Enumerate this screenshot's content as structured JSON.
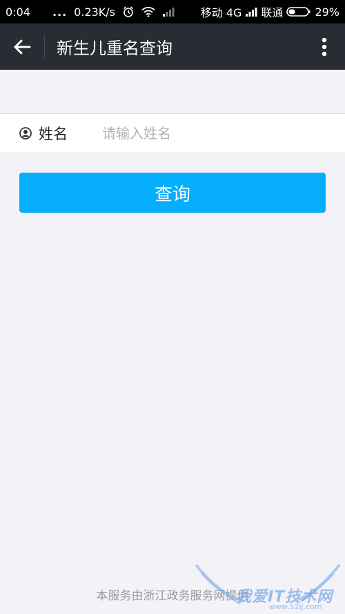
{
  "status_bar": {
    "time": "0:04",
    "dots": "...",
    "speed": "0.23K/s",
    "carrier1": "移动 4G",
    "carrier2": "联通",
    "battery": "29%",
    "icons": [
      "alarm-icon",
      "wifi-icon",
      "signal-icon",
      "signal-icon",
      "battery-icon"
    ]
  },
  "title_bar": {
    "title": "新生儿重名查询",
    "icons": [
      "back-arrow-icon",
      "more-vertical-icon"
    ]
  },
  "form": {
    "name_label": "姓名",
    "name_placeholder": "请输入姓名",
    "name_value": "",
    "icon": "user-icon"
  },
  "query_button": {
    "label": "查询"
  },
  "footer": {
    "note": "本服务由浙江政务服务网提供"
  },
  "watermark": {
    "text": "我爱IT技术网",
    "url": "www.52ij.com"
  },
  "colors": {
    "title_bar_bg": "#282c33",
    "button_bg": "#06aefb",
    "page_bg": "#f3f2f7"
  }
}
